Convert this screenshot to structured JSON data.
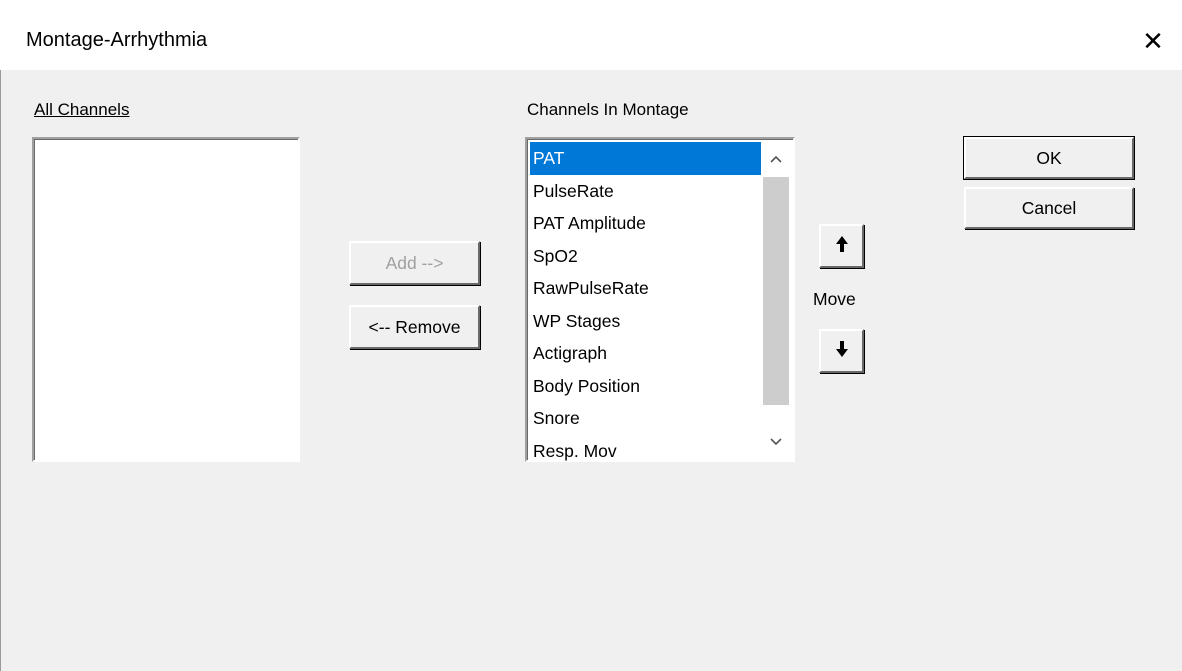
{
  "window": {
    "title": "Montage-Arrhythmia",
    "close_glyph": "✕"
  },
  "all_channels": {
    "label": "All Channels",
    "items": []
  },
  "montage": {
    "label": "Channels In Montage",
    "selected_index": 0,
    "items": [
      "PAT",
      "PulseRate",
      "PAT Amplitude",
      "SpO2",
      "RawPulseRate",
      "WP Stages",
      "Actigraph",
      "Body Position",
      "Snore",
      "Resp. Mov"
    ]
  },
  "buttons": {
    "add": "Add -->",
    "remove": "<-- Remove",
    "ok": "OK",
    "cancel": "Cancel",
    "move_label": "Move"
  },
  "scrollbar": {
    "up_glyph": "^",
    "down_glyph": "v"
  },
  "colors": {
    "selection": "#0078d7",
    "dialog_bg": "#f0f0f0"
  }
}
